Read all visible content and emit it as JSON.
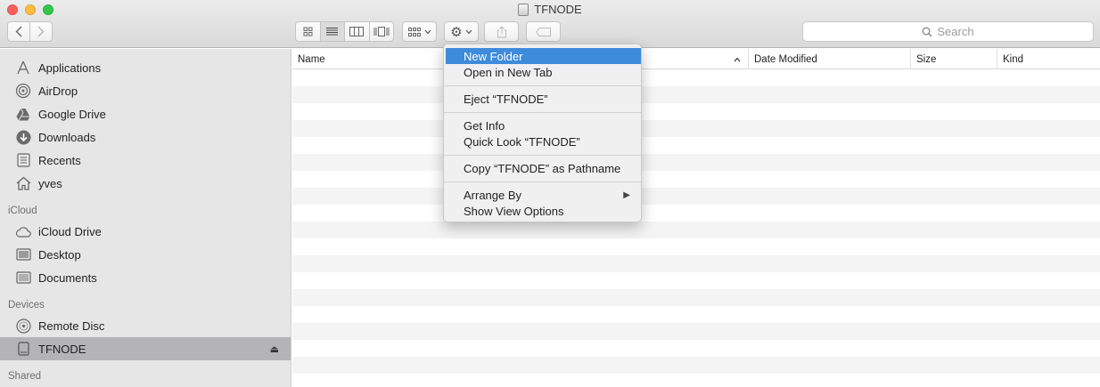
{
  "window": {
    "title": "TFNODE"
  },
  "toolbar": {
    "back_icon": "chevron-left-icon",
    "forward_icon": "chevron-right-icon",
    "views": [
      "icon-view-icon",
      "list-view-icon",
      "column-view-icon",
      "cover-flow-icon"
    ],
    "active_view": "list-view-icon",
    "arrange_icon": "grid-icon",
    "action_icon": "gear-icon",
    "search_placeholder": "Search"
  },
  "sidebar": {
    "favorites": [
      {
        "label": "Applications",
        "icon": "applications-icon"
      },
      {
        "label": "AirDrop",
        "icon": "airdrop-icon"
      },
      {
        "label": "Google Drive",
        "icon": "google-drive-icon"
      },
      {
        "label": "Downloads",
        "icon": "downloads-icon"
      },
      {
        "label": "Recents",
        "icon": "recents-icon"
      },
      {
        "label": "yves",
        "icon": "home-icon"
      }
    ],
    "icloud_header": "iCloud",
    "icloud": [
      {
        "label": "iCloud Drive",
        "icon": "cloud-icon"
      },
      {
        "label": "Desktop",
        "icon": "desktop-icon"
      },
      {
        "label": "Documents",
        "icon": "documents-icon"
      }
    ],
    "devices_header": "Devices",
    "devices": [
      {
        "label": "Remote Disc",
        "icon": "disc-icon"
      },
      {
        "label": "TFNODE",
        "icon": "drive-icon"
      }
    ],
    "shared_header": "Shared"
  },
  "columns": {
    "name": "Name",
    "date_modified": "Date Modified",
    "size": "Size",
    "kind": "Kind"
  },
  "context_menu": {
    "items": [
      "New Folder",
      "Open in New Tab",
      "Eject “TFNODE”",
      "Get Info",
      "Quick Look “TFNODE”",
      "Copy “TFNODE” as Pathname",
      "Arrange By",
      "Show View Options"
    ],
    "highlighted": "New Folder"
  },
  "colors": {
    "highlight": "#3f8bdb",
    "sidebar_bg": "#e6e6e6",
    "selected_row": "#b4b4b6"
  }
}
